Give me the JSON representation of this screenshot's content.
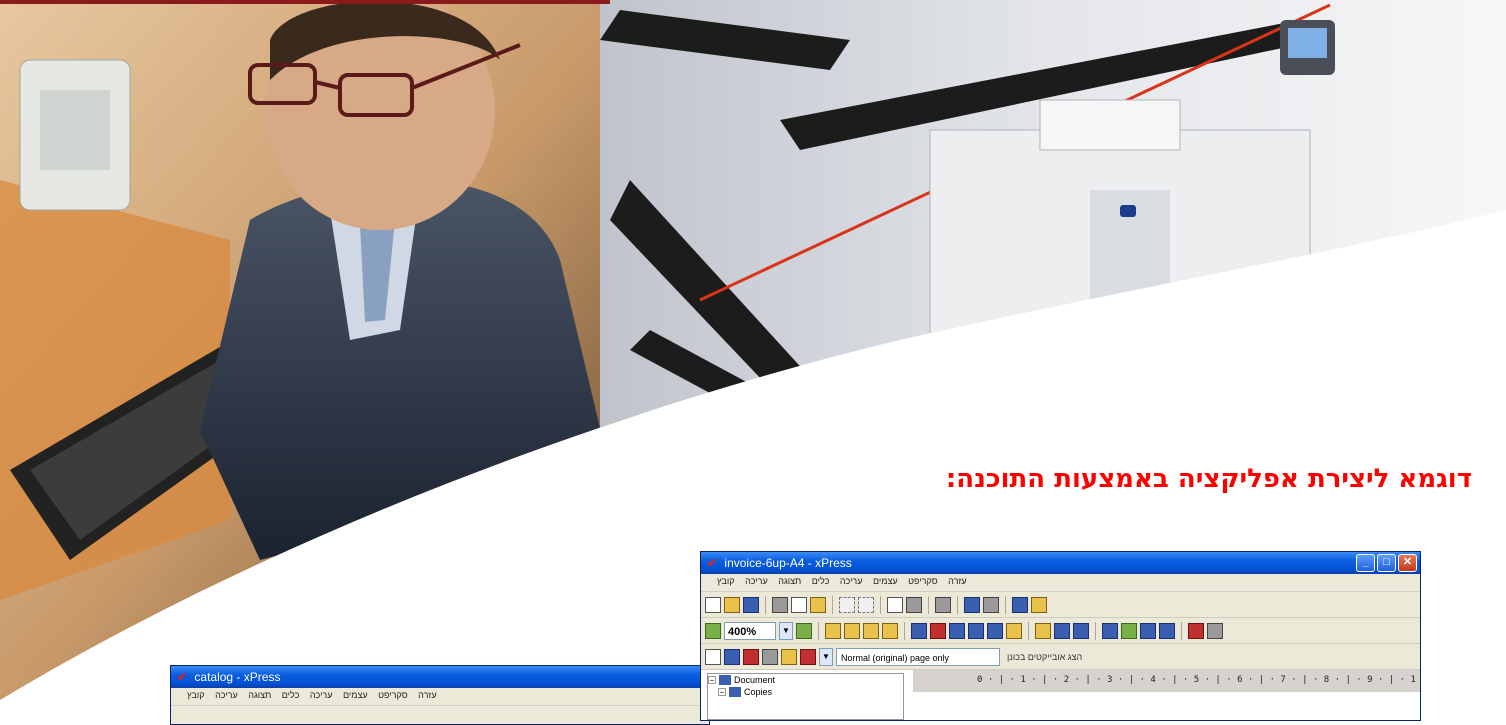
{
  "heading": "דוגמא ליצירת אפליקציה באמצעות התוכנה:",
  "windows": {
    "main": {
      "title": "invoice-6up-A4 - xPress",
      "menu": [
        "עזרה",
        "סקריפט",
        "עצמים",
        "עריכה",
        "כלים",
        "תצוגה",
        "עריכה",
        "קובץ"
      ],
      "zoom": "400%",
      "page_select": "Normal (original) page only",
      "hebrew_label": "הצג אובייקטים בכונן",
      "tree": [
        {
          "label": "Document",
          "icon": "document-icon",
          "indent": 0
        },
        {
          "label": "Copies",
          "icon": "copies-icon",
          "indent": 1
        }
      ],
      "ruler": "0 · | · 1 · | · 2 · | · 3 · | · 4 · | · 5 · | · 6 · | · 7 · | · 8 · | · 9 · | · 1"
    },
    "secondary": {
      "title": "catalog - xPress",
      "menu": [
        "עזרה",
        "סקריפט",
        "עצמים",
        "עריכה",
        "כלים",
        "תצוגה",
        "עריכה",
        "קובץ"
      ]
    }
  },
  "colors": {
    "heading": "#ff0000",
    "titlebar": "#0551d6",
    "close_button": "#c0391b"
  }
}
